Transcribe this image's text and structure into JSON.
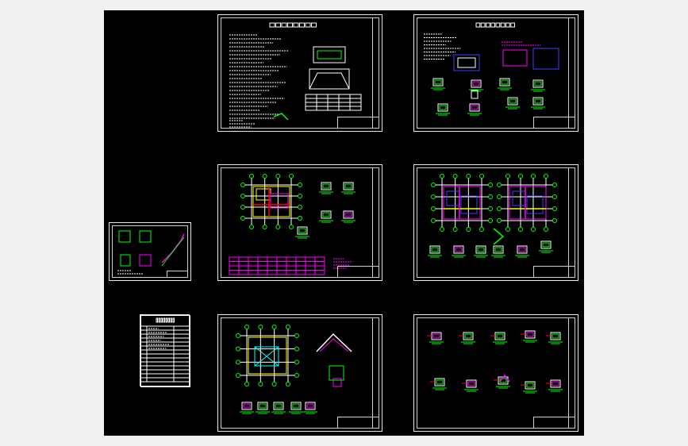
{
  "canvas": {
    "background": "#000000",
    "frame_color": "#f1f1f1"
  },
  "sheets": [
    {
      "id": "notes-1",
      "title": "",
      "kind": "notes"
    },
    {
      "id": "notes-2",
      "title": "",
      "kind": "notes-details"
    },
    {
      "id": "foundation-plan",
      "title": "",
      "kind": "plan"
    },
    {
      "id": "floor-plans",
      "title": "",
      "kind": "double-plan"
    },
    {
      "id": "stair-details",
      "title": "",
      "kind": "small-details"
    },
    {
      "id": "drawing-index",
      "title": "",
      "kind": "table"
    },
    {
      "id": "roof-plan",
      "title": "",
      "kind": "roof"
    },
    {
      "id": "node-details",
      "title": "",
      "kind": "details"
    }
  ],
  "colors": {
    "line": "#ffffff",
    "green": "#00ff00",
    "magenta": "#ff00ff",
    "yellow": "#ffff00",
    "red": "#ff0000",
    "cyan": "#00ffff",
    "blue": "#4040ff"
  }
}
